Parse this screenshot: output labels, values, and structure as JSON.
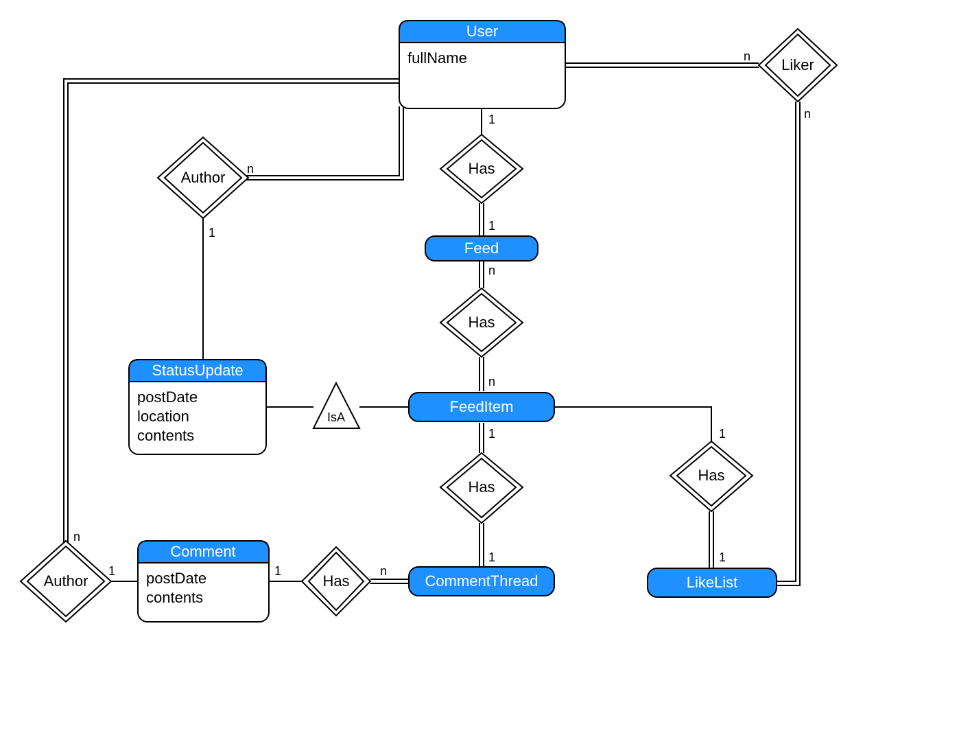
{
  "colors": {
    "accent": "#1E90FF",
    "stroke": "#000000",
    "white": "#ffffff"
  },
  "entities": {
    "user": {
      "name": "User",
      "attrs": [
        "fullName"
      ]
    },
    "statusUpdate": {
      "name": "StatusUpdate",
      "attrs": [
        "postDate",
        "location",
        "contents"
      ]
    },
    "comment": {
      "name": "Comment",
      "attrs": [
        "postDate",
        "contents"
      ]
    },
    "feed": {
      "name": "Feed"
    },
    "feedItem": {
      "name": "FeedItem"
    },
    "commentThread": {
      "name": "CommentThread"
    },
    "likeList": {
      "name": "LikeList"
    }
  },
  "relationships": {
    "authorStatus": {
      "label": "Author"
    },
    "authorComment": {
      "label": "Author"
    },
    "liker": {
      "label": "Liker"
    },
    "hasUserFeed": {
      "label": "Has"
    },
    "hasFeedItem": {
      "label": "Has"
    },
    "hasCommentThread": {
      "label": "Has"
    },
    "hasLikeList": {
      "label": "Has"
    },
    "hasComment": {
      "label": "Has"
    },
    "isA": {
      "label": "IsA"
    }
  },
  "cardinalities": {
    "user_has_feed_top": "1",
    "feed_has_user_bottom": "1",
    "feed_has_item_top": "n",
    "feeditem_has_feed_bottom": "n",
    "feeditem_has_ct_top": "1",
    "ct_has_feeditem_bottom": "1",
    "comment_has_ct_left": "1",
    "ct_has_comment_right": "n",
    "author_status_top": "n",
    "author_status_bottom": "1",
    "author_comment_top": "n",
    "author_comment_right": "1",
    "liker_user_left": "n",
    "liker_likelist_bottom": "n",
    "feeditem_has_likelist_top": "1",
    "likelist_has_feeditem_bottom": "1"
  }
}
